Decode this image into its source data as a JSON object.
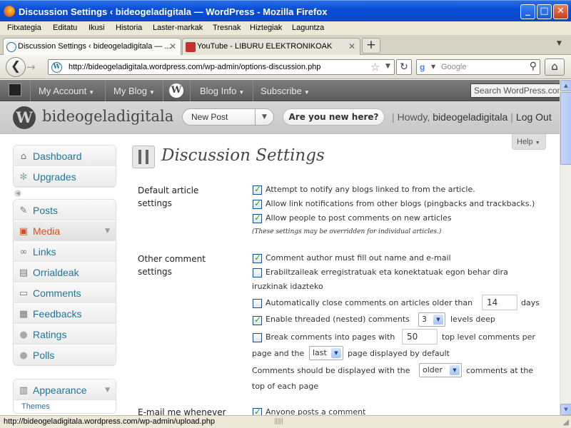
{
  "window": {
    "title": "Discussion Settings ‹ bideogeladigitala — WordPress - Mozilla Firefox",
    "min": "_",
    "max": "□",
    "close": "✕"
  },
  "menu": [
    "Fitxategia",
    "Editatu",
    "Ikusi",
    "Historia",
    "Laster-markak",
    "Tresnak",
    "Hiztegiak",
    "Laguntza"
  ],
  "tabs": [
    {
      "label": "Discussion Settings ‹ bideogeladigitala — ...",
      "close": "✕"
    },
    {
      "label": "YouTube - LIBURU ELEKTRONIKOAK",
      "close": "✕"
    }
  ],
  "newtab": "+",
  "nav": {
    "back": "❮",
    "forward": "→",
    "url": "http://bideogeladigitala.wordpress.com/wp-admin/options-discussion.php",
    "search_placeholder": "Google",
    "reload": "↻",
    "home": "⌂"
  },
  "wpbar": {
    "items": [
      "My Account",
      "My Blog",
      "Blog Info",
      "Subscribe"
    ],
    "search": "Search WordPress.com"
  },
  "header": {
    "site_name": "bideogeladigitala",
    "new_post": "New Post",
    "new_here": "Are you new here?",
    "howdy": "Howdy,",
    "user": "bideogeladigitala",
    "logout": "Log Out"
  },
  "sidebar": {
    "group1": [
      {
        "label": "Dashboard",
        "icon": "house-icon"
      },
      {
        "label": "Upgrades",
        "icon": "gear-icon"
      }
    ],
    "group2": [
      {
        "label": "Posts",
        "icon": "pin-icon"
      },
      {
        "label": "Media",
        "icon": "media-icon"
      },
      {
        "label": "Links",
        "icon": "link-icon"
      },
      {
        "label": "Orrialdeak",
        "icon": "page-icon"
      },
      {
        "label": "Comments",
        "icon": "comment-icon"
      },
      {
        "label": "Feedbacks",
        "icon": "feedback-icon"
      },
      {
        "label": "Ratings",
        "icon": "ratings-icon"
      },
      {
        "label": "Polls",
        "icon": "polls-icon"
      }
    ],
    "group3": [
      {
        "label": "Appearance",
        "icon": "appearance-icon"
      }
    ],
    "sub": "Themes"
  },
  "content": {
    "help": "Help",
    "title": "Discussion Settings",
    "default_label_1": "Default article",
    "default_label_2": "settings",
    "opt1": "Attempt to notify any blogs linked to from the article.",
    "opt2": "Allow link notifications from other blogs (pingbacks and trackbacks.)",
    "opt3": "Allow people to post comments on new articles",
    "note": "(These settings may be overridden for individual articles.)",
    "other_label_1": "Other comment",
    "other_label_2": "settings",
    "o1": "Comment author must fill out name and e-mail",
    "o2a": "Erabiltzaileak erregistratuak eta konektatuak egon behar dira",
    "o2b": "iruzkinak idazteko",
    "o3a": "Automatically close comments on articles older than",
    "o3val": "14",
    "o3b": "days",
    "o4a": "Enable threaded (nested) comments",
    "o4val": "3",
    "o4b": "levels deep",
    "o5a": "Break comments into pages with",
    "o5val": "50",
    "o5b": "top level comments per",
    "o5c": "page and the",
    "o5sel": "last",
    "o5d": "page displayed by default",
    "o6a": "Comments should be displayed with the",
    "o6sel": "older",
    "o6b": "comments at the",
    "o6c": "top of each page",
    "email_label": "E-mail me whenever",
    "email_opt": "Anyone posts a comment"
  },
  "status": {
    "url": "http://bideogeladigitala.wordpress.com/wp-admin/upload.php"
  }
}
